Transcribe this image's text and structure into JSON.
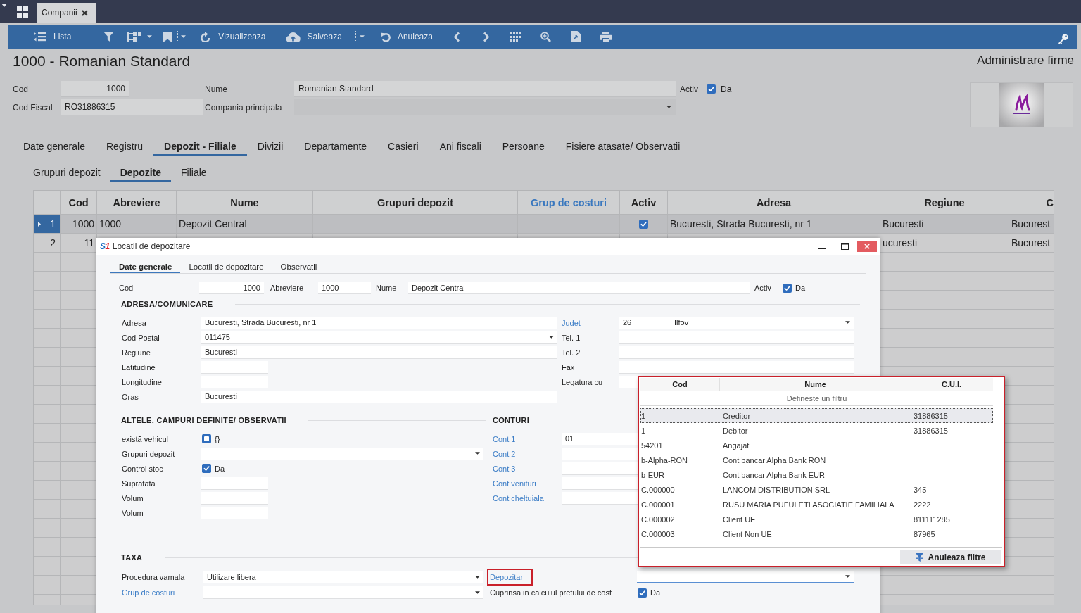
{
  "top_bar": {
    "tabs": [
      {
        "label": "Companii",
        "selected": true
      }
    ]
  },
  "toolbar": {
    "buttons": [
      {
        "label": "Lista"
      },
      {
        "label": "Vizualizeaza"
      },
      {
        "label": "Salveaza"
      },
      {
        "label": "Anuleaza"
      }
    ]
  },
  "header": {
    "title": "1000 - Romanian Standard",
    "module": "Administrare firme"
  },
  "company": {
    "cod": {
      "label": "Cod",
      "value": "1000"
    },
    "nume": {
      "label": "Nume",
      "value": "Romanian Standard"
    },
    "activ": {
      "label": "Activ",
      "checked": true,
      "text": "Da"
    },
    "cod_fiscal": {
      "label": "Cod Fiscal",
      "value": "RO31886315"
    },
    "compania_principala": {
      "label": "Compania principala"
    }
  },
  "tabs": [
    {
      "label": "Date generale",
      "selected": false
    },
    {
      "label": "Registru",
      "selected": false
    },
    {
      "label": "Depozit - Filiale",
      "selected": true
    },
    {
      "label": "Divizii",
      "selected": false
    },
    {
      "label": "Departamente",
      "selected": false
    },
    {
      "label": "Casieri",
      "selected": false
    },
    {
      "label": "Ani fiscali",
      "selected": false
    },
    {
      "label": "Persoane",
      "selected": false
    },
    {
      "label": "Fisiere atasate/ Observatii",
      "selected": false
    }
  ],
  "subtabs": [
    {
      "label": "Grupuri depozit",
      "selected": false
    },
    {
      "label": "Depozite",
      "selected": true
    },
    {
      "label": "Filiale",
      "selected": false
    }
  ],
  "table": {
    "columns": [
      {
        "label": "Cod",
        "link": false
      },
      {
        "label": "Abreviere",
        "link": false
      },
      {
        "label": "Nume",
        "link": false
      },
      {
        "label": "Grupuri depozit",
        "link": false
      },
      {
        "label": "Grup de costuri",
        "link": true
      },
      {
        "label": "Activ",
        "link": false
      },
      {
        "label": "Adresa",
        "link": false
      },
      {
        "label": "Regiune",
        "link": false
      },
      {
        "label": "C",
        "link": false
      }
    ],
    "rows": [
      {
        "number": "1",
        "selected": true,
        "cod": "1000",
        "abreviere": "1000",
        "nume": "Depozit Central",
        "activ": true,
        "adresa": "Bucuresti, Strada Bucuresti, nr 1",
        "regiune": "Bucuresti",
        "column_9": "Bucurest"
      },
      {
        "number": "2",
        "selected": false,
        "cod": "11",
        "regiune": "ucuresti",
        "column_9": "Bucurest"
      }
    ]
  },
  "dialog": {
    "logo": "S1",
    "title": "Locatii de depozitare",
    "tabs": [
      {
        "label": "Date generale",
        "selected": true
      },
      {
        "label": "Locatii de depozitare",
        "selected": false
      },
      {
        "label": "Observatii",
        "selected": false
      }
    ],
    "cod": {
      "label": "Cod",
      "value": "1000"
    },
    "abreviere": {
      "label": "Abreviere",
      "value": "1000"
    },
    "nume": {
      "label": "Nume",
      "value": "Depozit Central"
    },
    "activ": {
      "label": "Activ",
      "checked": true,
      "text": "Da"
    },
    "address": {
      "title": "ADRESA/COMUNICARE",
      "left": [
        {
          "kind": "text",
          "label": "Adresa",
          "value": "Bucuresti, Strada Bucuresti, nr 1"
        },
        {
          "kind": "dropdown",
          "label": "Cod Postal",
          "value": "011475"
        },
        {
          "kind": "text",
          "label": "Regiune",
          "value": "Bucuresti"
        },
        {
          "kind": "short",
          "label": "Latitudine"
        },
        {
          "kind": "short",
          "label": "Longitudine"
        },
        {
          "kind": "text",
          "label": "Oras",
          "value": "Bucuresti"
        }
      ],
      "right": [
        {
          "kind": "dropdown",
          "label": "Judet",
          "link": true,
          "code": "26",
          "value": "Ilfov"
        },
        {
          "kind": "text",
          "label": "Tel. 1",
          "link": false
        },
        {
          "kind": "text",
          "label": "Tel. 2",
          "link": false
        },
        {
          "kind": "text",
          "label": "Fax",
          "link": false
        },
        {
          "kind": "text",
          "label": "Legatura cu",
          "link": false
        }
      ]
    },
    "other": {
      "title": "ALTELE, CAMPURI DEFINITE/ OBSERVATII",
      "fields": [
        {
          "kind": "checkbox",
          "label": "există vehicul",
          "checked": false,
          "text": "{}"
        },
        {
          "kind": "dropdown",
          "label": "Grupuri depozit"
        },
        {
          "kind": "checkbox",
          "label": "Control stoc",
          "checked": true,
          "text": "Da"
        },
        {
          "kind": "short",
          "label": "Suprafata"
        },
        {
          "kind": "short",
          "label": "Volum"
        },
        {
          "kind": "short",
          "label": "Volum"
        }
      ]
    },
    "accounts": {
      "title": "CONTURI",
      "fields": [
        {
          "kind": "text",
          "label": "Cont 1",
          "link": true,
          "value": "01"
        },
        {
          "kind": "text",
          "label": "Cont 2",
          "link": true
        },
        {
          "kind": "text",
          "label": "Cont 3",
          "link": true
        },
        {
          "kind": "text",
          "label": "Cont venituri",
          "link": true
        },
        {
          "kind": "text",
          "label": "Cont cheltuiala",
          "link": true
        }
      ]
    },
    "tax": {
      "title": "TAXA",
      "fields": [
        {
          "kind": "dropdown",
          "label": "Procedura vamala",
          "link": false,
          "highlighted": false,
          "focused": false,
          "value": "Utilizare libera"
        },
        {
          "kind": "dropdown",
          "label": "Depozitar",
          "link": true,
          "highlighted": true,
          "focused": true
        },
        {
          "kind": "dropdown",
          "label": "Grup de costuri",
          "link": true,
          "highlighted": false,
          "focused": false
        },
        {
          "kind": "checkbox",
          "label": "Cuprinsa in calculul pretului de cost",
          "link": false,
          "highlighted": false,
          "checked": true,
          "text": "Da"
        }
      ]
    }
  },
  "lookup": {
    "highlighted": true,
    "columns": [
      "Cod",
      "Nume",
      "C.U.I."
    ],
    "filter": {
      "placeholder": "Defineste un filtru"
    },
    "rows": [
      {
        "cod": "1",
        "nume": "Creditor",
        "cui": "31886315",
        "selected": true
      },
      {
        "cod": "1",
        "nume": "Debitor",
        "cui": "31886315",
        "selected": false
      },
      {
        "cod": "54201",
        "nume": "Angajat",
        "selected": false
      },
      {
        "cod": "b-Alpha-RON",
        "nume": "Cont bancar Alpha Bank RON",
        "selected": false
      },
      {
        "cod": "b-EUR",
        "nume": "Cont bancar Alpha Bank EUR",
        "selected": false
      },
      {
        "cod": "C.000000",
        "nume": "LANCOM DISTRIBUTION SRL",
        "cui": "345",
        "selected": false
      },
      {
        "cod": "C.000001",
        "nume": "RUSU MARIA PUFULETI ASOCIATIE FAMILIALA",
        "cui": "2222",
        "selected": false
      },
      {
        "cod": "C.000002",
        "nume": "Client UE",
        "cui": "811111285",
        "selected": false
      },
      {
        "cod": "C.000003",
        "nume": "Client Non UE",
        "cui": "87965",
        "selected": false
      }
    ],
    "button": {
      "label": "Anuleaza filtre"
    }
  }
}
